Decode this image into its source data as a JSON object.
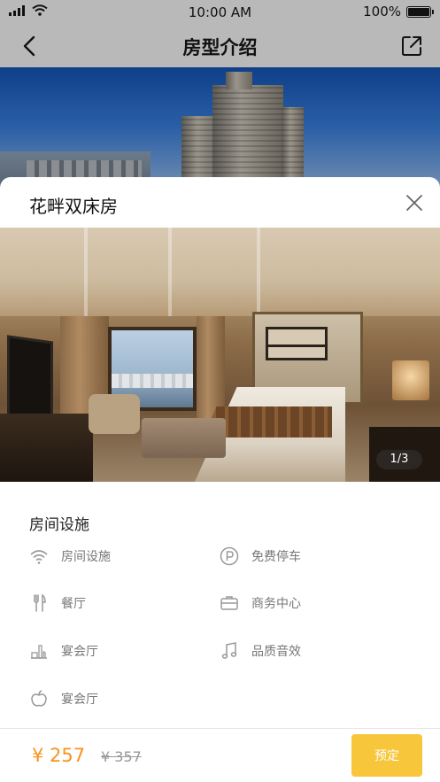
{
  "status_bar": {
    "time": "10:00 AM",
    "battery_label": "100%",
    "battery_level": 1.0
  },
  "nav": {
    "title": "房型介绍",
    "back_icon": "chevron-left-icon",
    "share_icon": "share-external-icon"
  },
  "room": {
    "name": "花畔双床房",
    "photo_counter": "1/3",
    "close_icon": "close-icon"
  },
  "facilities": {
    "heading": "房间设施",
    "items": [
      {
        "label": "房间设施",
        "icon": "wifi-icon"
      },
      {
        "label": "免费停车",
        "icon": "parking-icon"
      },
      {
        "label": "餐厅",
        "icon": "fork-knife-icon"
      },
      {
        "label": "商务中心",
        "icon": "briefcase-icon"
      },
      {
        "label": "宴会厅",
        "icon": "banquet-icon"
      },
      {
        "label": "品质音效",
        "icon": "music-note-icon"
      },
      {
        "label": "宴会厅",
        "icon": "apple-icon"
      }
    ]
  },
  "booking": {
    "price": "¥ 257",
    "original_price": "¥ 357",
    "book_label": "预定",
    "accent_color": "#f7941d",
    "button_color": "#f7c63a"
  }
}
